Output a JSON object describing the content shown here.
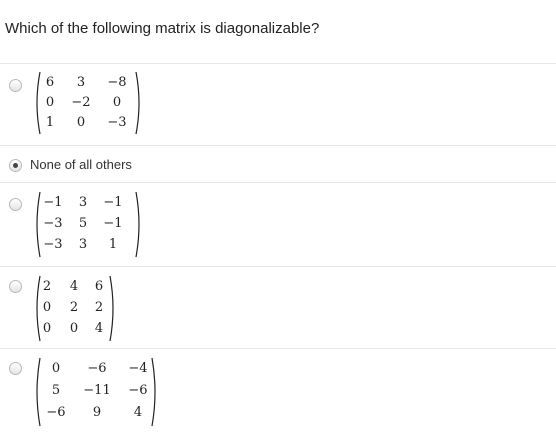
{
  "question": "Which of the following matrix is diagonalizable?",
  "options": [
    {
      "type": "matrix",
      "checked": false,
      "matrix": [
        [
          "6",
          "3",
          "−8"
        ],
        [
          "0",
          "−2",
          "0"
        ],
        [
          "1",
          "0",
          "−3"
        ]
      ]
    },
    {
      "type": "text",
      "checked": true,
      "label": "None of all others"
    },
    {
      "type": "matrix",
      "checked": false,
      "matrix": [
        [
          "−1",
          "3",
          "−1"
        ],
        [
          "−3",
          "5",
          "−1"
        ],
        [
          "−3",
          "3",
          "1"
        ]
      ]
    },
    {
      "type": "matrix",
      "checked": false,
      "matrix": [
        [
          "2",
          "4",
          "6"
        ],
        [
          "0",
          "2",
          "2"
        ],
        [
          "0",
          "0",
          "4"
        ]
      ]
    },
    {
      "type": "matrix",
      "checked": false,
      "matrix": [
        [
          "0",
          "−6",
          "−4"
        ],
        [
          "5",
          "−11",
          "−6"
        ],
        [
          "−6",
          "9",
          "4"
        ]
      ]
    }
  ]
}
